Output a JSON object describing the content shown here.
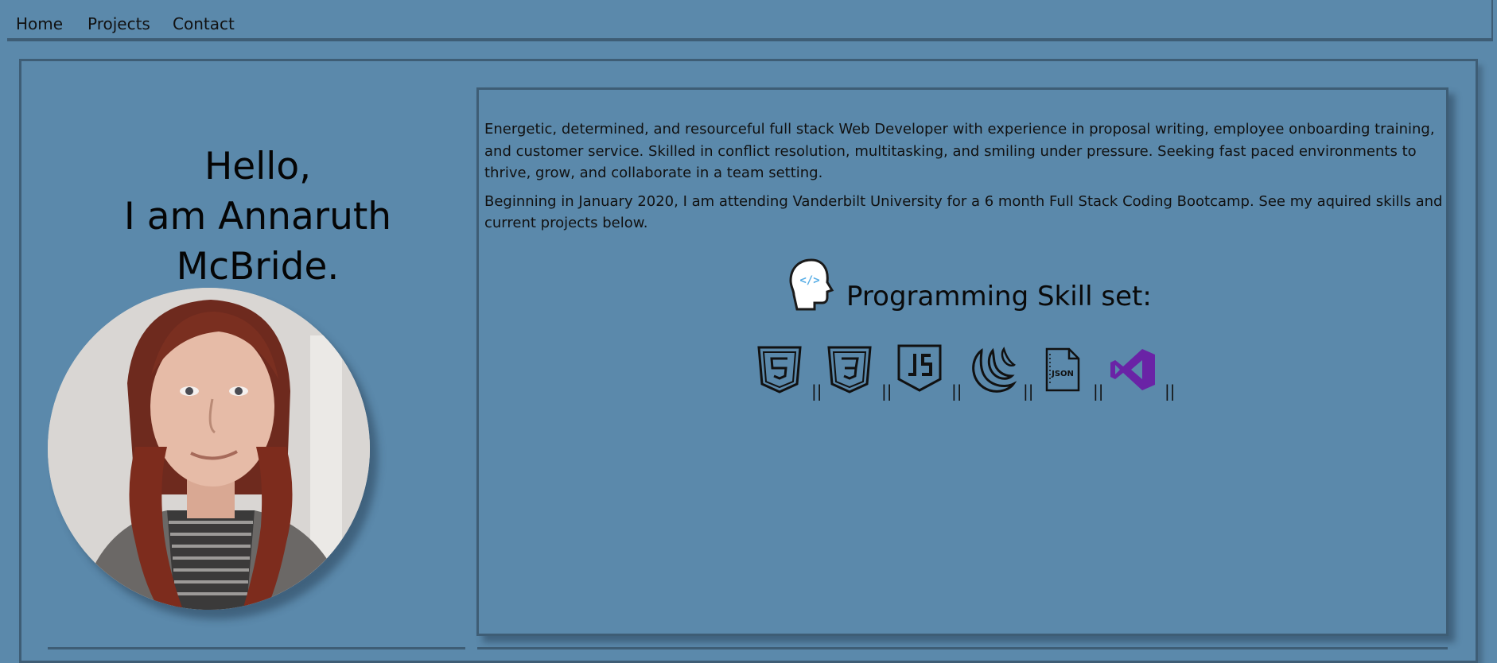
{
  "nav": {
    "items": [
      "Home",
      "Projects",
      "Contact"
    ]
  },
  "hero": {
    "greeting_line1": "Hello,",
    "greeting_line2": "I am Annaruth McBride."
  },
  "bio": {
    "paragraph1": "Energetic, determined, and resourceful full stack Web Developer with experience in proposal writing, employee onboarding training, and customer service. Skilled in conflict resolution, multitasking, and smiling under pressure. Seeking fast paced environments to thrive, grow, and collaborate in a team setting.",
    "paragraph2": "Beginning in January 2020, I am attending Vanderbilt University for a 6 month Full Stack Coding Bootcamp. See my aquired skills and current projects below."
  },
  "skills": {
    "title": "Programming Skill set:",
    "separator": "||",
    "icons": [
      "html5-icon",
      "css3-icon",
      "javascript-icon",
      "jquery-icon",
      "json-file-icon",
      "visual-studio-icon"
    ],
    "json_label": "JSON"
  },
  "colors": {
    "background": "#5b89ab",
    "border": "#3e5d75",
    "visual_studio": "#6a23a6",
    "code_icon": "#58aee6"
  }
}
